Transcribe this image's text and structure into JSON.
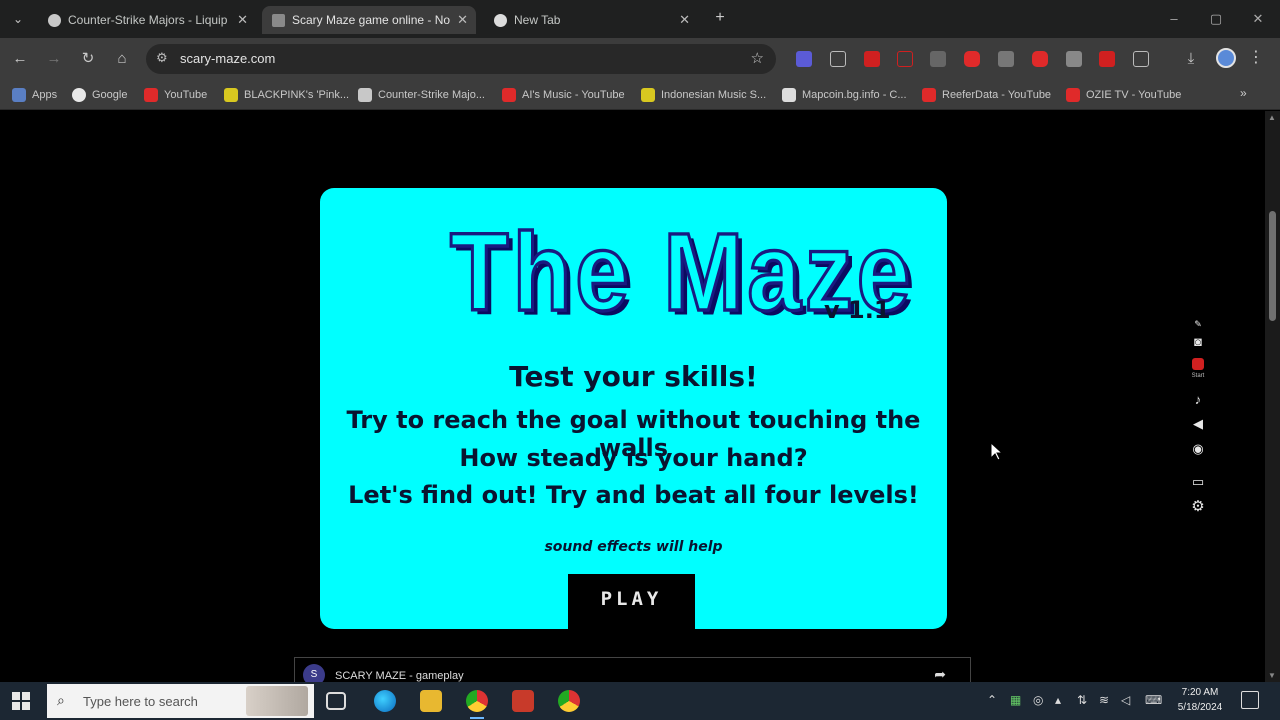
{
  "browser": {
    "tabs": [
      {
        "title": "Counter-Strike Majors - Liquip",
        "active": false
      },
      {
        "title": "Scary Maze game online - No",
        "active": true
      },
      {
        "title": "New Tab",
        "active": false
      }
    ],
    "url": "scary-maze.com",
    "bookmarks": [
      {
        "label": "Apps"
      },
      {
        "label": "Google"
      },
      {
        "label": "YouTube"
      },
      {
        "label": "BLACKPINK's 'Pink..."
      },
      {
        "label": "Counter-Strike Majo..."
      },
      {
        "label": "AI's Music - YouTube"
      },
      {
        "label": "Indonesian Music S..."
      },
      {
        "label": "Mapcoin.bg.info - C..."
      },
      {
        "label": "ReeferData - YouTube"
      },
      {
        "label": "OZIE TV - YouTube"
      }
    ]
  },
  "game": {
    "title": "The  Maze",
    "version": "v 1.1",
    "line1": "Test your skills!",
    "line2": "Try to reach the goal without touching the walls",
    "line3": "How steady is your hand?",
    "line4": "Let's find out! Try and beat all four levels!",
    "hint": "sound effects will help",
    "play_label": "PLAY",
    "bg_color": "#00ffff"
  },
  "video": {
    "avatar": "S",
    "title": "SCARY MAZE - gameplay"
  },
  "recorder": {
    "rec_label": "Start"
  },
  "taskbar": {
    "search_placeholder": "Type here to search",
    "time": "7:20 AM",
    "date": "5/18/2024"
  }
}
